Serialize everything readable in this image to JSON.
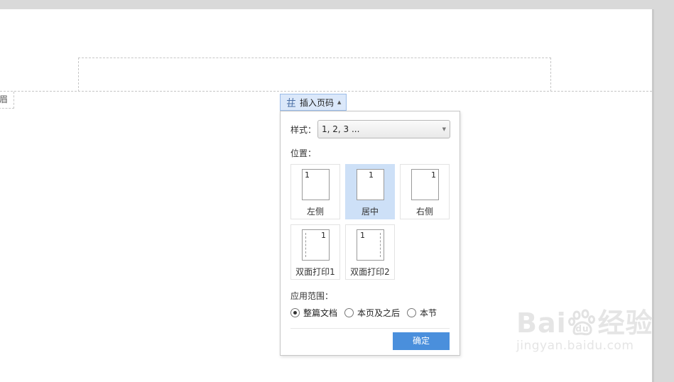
{
  "document": {
    "header_tag": "眉"
  },
  "insert_button": {
    "label": "插入页码",
    "icon": "page-number-hash-icon"
  },
  "panel": {
    "style_label": "样式：",
    "style_value": "1, 2, 3 ...",
    "position_label": "位置：",
    "positions": [
      {
        "name": "左侧",
        "number": "1",
        "selected": false
      },
      {
        "name": "居中",
        "number": "1",
        "selected": true
      },
      {
        "name": "右侧",
        "number": "1",
        "selected": false
      },
      {
        "name": "双面打印1",
        "number": "1",
        "selected": false
      },
      {
        "name": "双面打印2",
        "number": "1",
        "selected": false
      }
    ],
    "range_label": "应用范围：",
    "range_options": [
      {
        "label": "整篇文档",
        "checked": true
      },
      {
        "label": "本页及之后",
        "checked": false
      },
      {
        "label": "本节",
        "checked": false
      }
    ],
    "ok_label": "确定"
  },
  "watermark": {
    "brand_left": "Bai",
    "brand_right": "经验",
    "url": "jingyan.baidu.com"
  },
  "colors": {
    "accent": "#4a8fdc",
    "selected_tile": "#cde0f7",
    "insert_button_bg": "#dbe8fa"
  }
}
